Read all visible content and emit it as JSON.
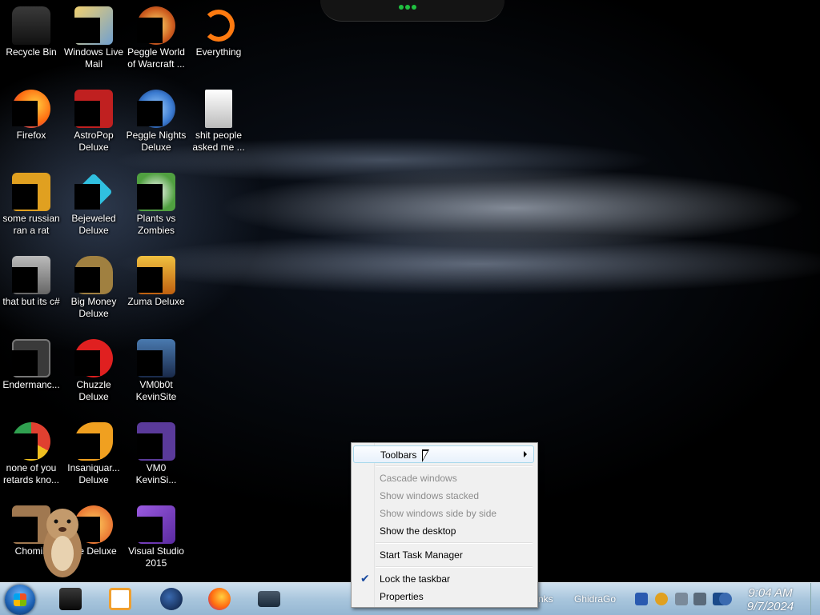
{
  "desktop": {
    "icons": [
      {
        "label": "Recycle Bin",
        "icon": "recycle-bin-icon",
        "color": "#2a2a2a"
      },
      {
        "label": "Windows Live Mail",
        "icon": "mail-icon",
        "color": "#e0c060"
      },
      {
        "label": "Peggle World of Warcraft ...",
        "icon": "peggle-icon",
        "color": "#d06020"
      },
      {
        "label": "Everything",
        "icon": "everything-icon",
        "color": "#ff7a10"
      },
      {
        "label": "Firefox",
        "icon": "firefox-icon",
        "color": "#ff8a20"
      },
      {
        "label": "AstroPop Deluxe",
        "icon": "astropop-icon",
        "color": "#c02020"
      },
      {
        "label": "Peggle Nights Deluxe",
        "icon": "peggle-nights-icon",
        "color": "#3a7ad0"
      },
      {
        "label": "shit people asked me ...",
        "icon": "file-icon",
        "color": "#e8e8e8"
      },
      {
        "label": "some russian ran a rat",
        "icon": "jar-icon",
        "color": "#e0a020"
      },
      {
        "label": "Bejeweled Deluxe",
        "icon": "bejeweled-icon",
        "color": "#30c0e0"
      },
      {
        "label": "Plants vs Zombies",
        "icon": "pvz-icon",
        "color": "#50a040"
      },
      {
        "label": "that but its c#",
        "icon": "shortcut-icon",
        "color": "#8a8a8a"
      },
      {
        "label": "Big Money Deluxe",
        "icon": "money-bag-icon",
        "color": "#a08040"
      },
      {
        "label": "Zuma Deluxe",
        "icon": "zuma-icon",
        "color": "#e0a020"
      },
      {
        "label": "Endermanc...",
        "icon": "app-window-icon",
        "color": "#3a3a3a"
      },
      {
        "label": "Chuzzle Deluxe",
        "icon": "chuzzle-icon",
        "color": "#e02020"
      },
      {
        "label": "VM0b0t KevinSite",
        "icon": "vm-icon",
        "color": "#2a4a7a"
      },
      {
        "label": "none of you retards kno...",
        "icon": "chrome-icon",
        "color": "#e04030"
      },
      {
        "label": "Insaniquar... Deluxe",
        "icon": "fish-icon",
        "color": "#f0a020"
      },
      {
        "label": "VM0 KevinSi...",
        "icon": "file-purple-icon",
        "color": "#5a3a9a"
      },
      {
        "label": "Chomik",
        "icon": "chomik-icon",
        "color": "#c09060"
      },
      {
        "label": "...e Deluxe",
        "icon": "game-icon",
        "color": "#e05020"
      },
      {
        "label": "Visual Studio 2015",
        "icon": "visual-studio-icon",
        "color": "#7a3ac0"
      }
    ]
  },
  "taskbar": {
    "apps": [
      {
        "icon": "terminal-icon",
        "color": "#202020"
      },
      {
        "icon": "media-player-icon",
        "color": "#f0a030"
      },
      {
        "icon": "globe-icon",
        "color": "#1a3a7a"
      },
      {
        "icon": "firefox-icon",
        "color": "#ff7a20"
      },
      {
        "icon": "monitor-icon",
        "color": "#2a3a4a"
      }
    ],
    "toolbar_items": [
      "nks",
      "GhidraGo"
    ],
    "tray_icons": [
      {
        "icon": "shield-icon",
        "color": "#2a5ab0"
      },
      {
        "icon": "search-icon",
        "color": "#e0a020"
      },
      {
        "icon": "network-icon",
        "color": "#7a8a9a"
      },
      {
        "icon": "volume-icon",
        "color": "#5a6a7a"
      },
      {
        "icon": "display-icon",
        "color": "#1a4a8a"
      },
      {
        "icon": "antivirus-icon",
        "color": "#3a6ab0"
      }
    ],
    "clock": {
      "time": "9:04 AM",
      "date": "9/7/2024"
    }
  },
  "context_menu": {
    "toolbars": "Toolbars",
    "cascade": "Cascade windows",
    "stacked": "Show windows stacked",
    "side_by_side": "Show windows side by side",
    "show_desktop": "Show the desktop",
    "task_manager": "Start Task Manager",
    "lock_taskbar": "Lock the taskbar",
    "properties": "Properties",
    "check_mark": "✔"
  }
}
